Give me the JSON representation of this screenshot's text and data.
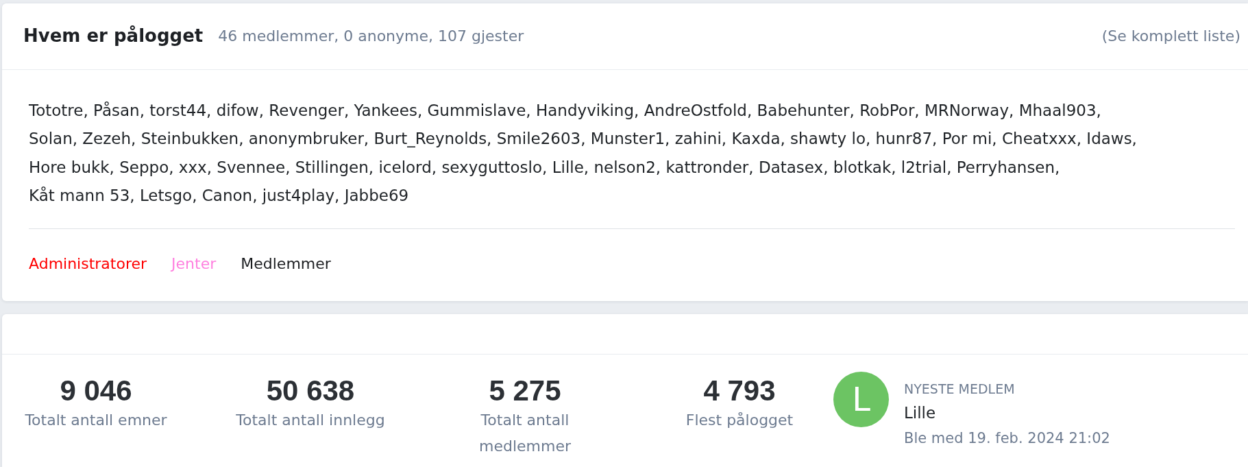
{
  "online_panel": {
    "title": "Hvem er pålogget",
    "summary": "46 medlemmer, 0 anonyme, 107 gjester",
    "full_list_link": "(Se komplett liste)",
    "user_lines": [
      "Tototre, Påsan, torst44, difow, Revenger, Yankees, Gummislave, Handyviking, AndreOstfold, Babehunter, RobPor, MRNorway, Mhaal903,",
      "Solan, Zezeh, Steinbukken, anonymbruker, Burt_Reynolds, Smile2603, Munster1, zahini, Kaxda, shawty lo, hunr87, Por mi, Cheatxxx, Idaws,",
      "Hore bukk, Seppo, xxx, Svennee, Stillingen, icelord, sexyguttoslo, Lille, nelson2, kattronder, Datasex, blotkak, l2trial, Perryhansen,",
      "Kåt mann 53, Letsgo, Canon, just4play, Jabbe69"
    ],
    "legend": [
      {
        "label": "Administratorer",
        "color": "#ff0000"
      },
      {
        "label": "Jenter",
        "color": "#ff80df"
      },
      {
        "label": "Medlemmer",
        "color": "#1c1e21"
      }
    ]
  },
  "statistics": {
    "stats": [
      {
        "value": "9 046",
        "label": "Totalt antall emner"
      },
      {
        "value": "50 638",
        "label": "Totalt antall innlegg"
      },
      {
        "value": "5 275",
        "label": "Totalt antall medlemmer"
      },
      {
        "value": "4 793",
        "label": "Flest pålogget"
      }
    ],
    "newest_member": {
      "heading": "NYESTE MEDLEM",
      "avatar_letter": "L",
      "name": "Lille",
      "joined": "Ble med 19. feb. 2024 21:02"
    }
  }
}
